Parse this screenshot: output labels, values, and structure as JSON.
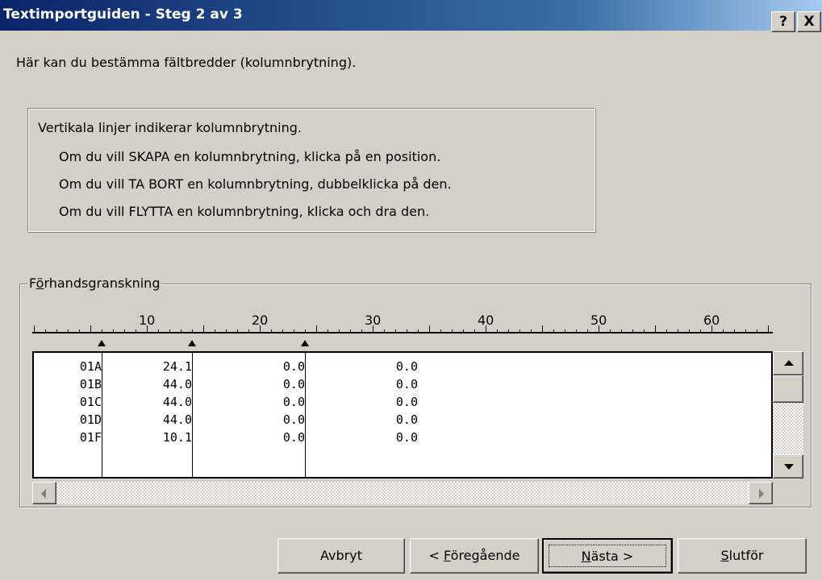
{
  "window": {
    "title": "Textimportguiden - Steg 2 av 3",
    "help_button": "?",
    "close_button": "X"
  },
  "intro": "Här kan du bestämma fältbredder (kolumnbrytning).",
  "info": {
    "heading": "Vertikala linjer indikerar kolumnbrytning.",
    "lines": [
      "Om du vill SKAPA en kolumnbrytning, klicka på en position.",
      "Om du vill TA BORT en kolumnbrytning, dubbelklicka på den.",
      "Om du vill FLYTTA en kolumnbrytning, klicka och dra den."
    ]
  },
  "preview": {
    "group_label_prefix": "F",
    "group_label_mnemonic": "ö",
    "group_label_rest": "rhandsgranskning",
    "ruler_labels": [
      "10",
      "20",
      "30",
      "40",
      "50",
      "60"
    ],
    "column_breaks": [
      6,
      14,
      24
    ],
    "rows": [
      [
        "01A",
        "24.1",
        "0.0",
        "0.0"
      ],
      [
        "01B",
        "44.0",
        "0.0",
        "0.0"
      ],
      [
        "01C",
        "44.0",
        "0.0",
        "0.0"
      ],
      [
        "01D",
        "44.0",
        "0.0",
        "0.0"
      ],
      [
        "01F",
        "10.1",
        "0.0",
        "0.0"
      ]
    ]
  },
  "buttons": {
    "cancel": "Avbryt",
    "back_prefix": "< ",
    "back_mnemonic": "F",
    "back_rest": "öregående",
    "next_mnemonic": "N",
    "next_rest": "ästa >",
    "finish_mnemonic": "S",
    "finish_rest": "lutför"
  }
}
